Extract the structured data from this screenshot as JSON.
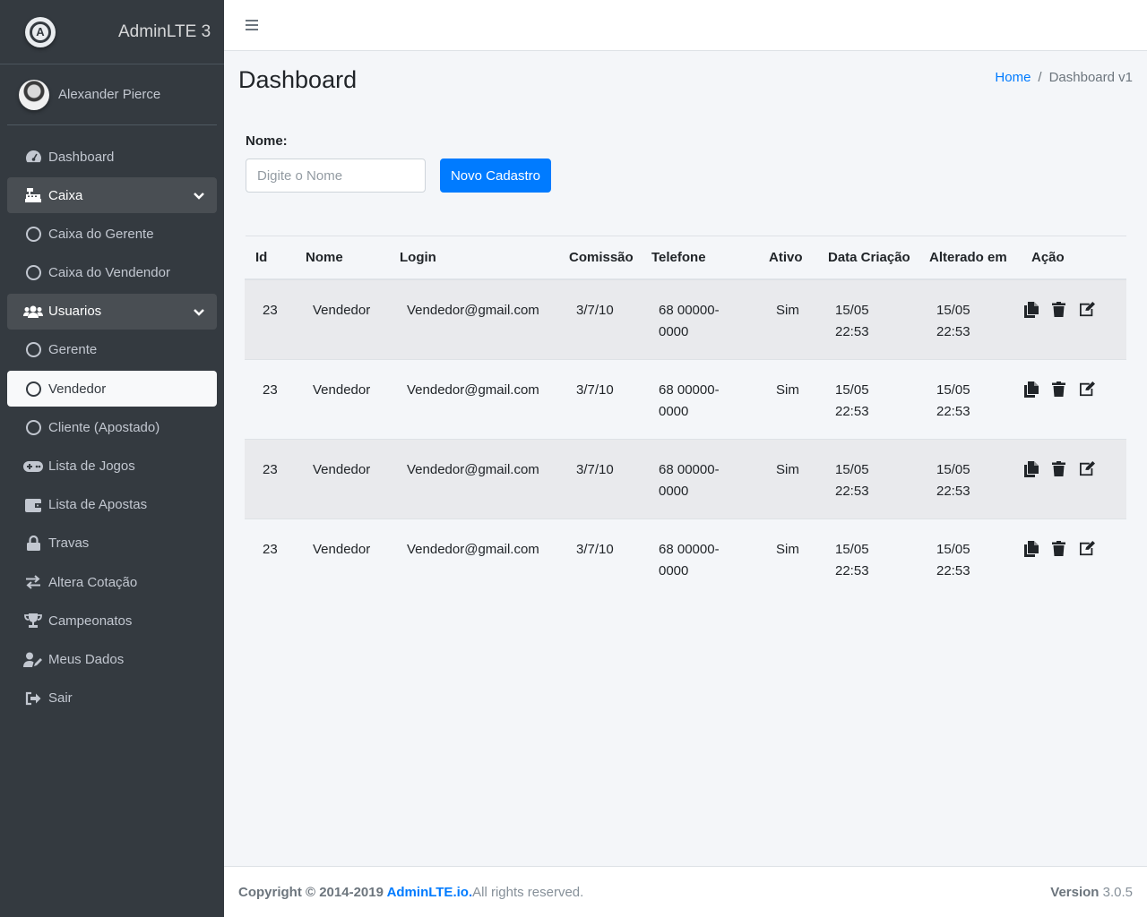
{
  "brand": {
    "title": "AdminLTE 3",
    "logo_letter": "A"
  },
  "user": {
    "name": "Alexander Pierce"
  },
  "sidebar": {
    "items": [
      {
        "label": "Dashboard",
        "icon": "tachometer-icon"
      },
      {
        "label": "Caixa",
        "icon": "cash-register-icon",
        "expanded": true
      },
      {
        "label": "Caixa do Gerente",
        "icon": "circle-icon"
      },
      {
        "label": "Caixa do Vendendor",
        "icon": "circle-icon"
      },
      {
        "label": "Usuarios",
        "icon": "users-icon",
        "expanded": true
      },
      {
        "label": "Gerente",
        "icon": "circle-icon"
      },
      {
        "label": "Vendedor",
        "icon": "circle-icon",
        "active": true
      },
      {
        "label": "Cliente (Apostado)",
        "icon": "circle-icon"
      },
      {
        "label": "Lista de Jogos",
        "icon": "gamepad-icon"
      },
      {
        "label": "Lista de Apostas",
        "icon": "wallet-icon"
      },
      {
        "label": "Travas",
        "icon": "lock-icon"
      },
      {
        "label": "Altera Cotação",
        "icon": "exchange-icon"
      },
      {
        "label": "Campeonatos",
        "icon": "trophy-icon"
      },
      {
        "label": "Meus Dados",
        "icon": "user-edit-icon"
      },
      {
        "label": "Sair",
        "icon": "sign-out-icon"
      }
    ]
  },
  "header": {
    "page_title": "Dashboard",
    "breadcrumb_home": "Home",
    "breadcrumb_current": "Dashboard v1",
    "breadcrumb_sep": "/"
  },
  "form": {
    "name_label": "Nome:",
    "name_placeholder": "Digite o Nome",
    "new_button": "Novo Cadastro"
  },
  "table": {
    "columns": [
      "Id",
      "Nome",
      "Login",
      "Comissão",
      "Telefone",
      "Ativo",
      "Data Criação",
      "Alterado em",
      "Ação"
    ],
    "rows": [
      {
        "id": "23",
        "nome": "Vendedor",
        "login": "Vendedor@gmail.com",
        "comissao": "3/7/10",
        "telefone_1": "68 00000-",
        "telefone_2": "0000",
        "ativo": "Sim",
        "criacao_1": "15/05",
        "criacao_2": "22:53",
        "alterado_1": "15/05",
        "alterado_2": "22:53"
      },
      {
        "id": "23",
        "nome": "Vendedor",
        "login": "Vendedor@gmail.com",
        "comissao": "3/7/10",
        "telefone_1": "68 00000-",
        "telefone_2": "0000",
        "ativo": "Sim",
        "criacao_1": "15/05",
        "criacao_2": "22:53",
        "alterado_1": "15/05",
        "alterado_2": "22:53"
      },
      {
        "id": "23",
        "nome": "Vendedor",
        "login": "Vendedor@gmail.com",
        "comissao": "3/7/10",
        "telefone_1": "68 00000-",
        "telefone_2": "0000",
        "ativo": "Sim",
        "criacao_1": "15/05",
        "criacao_2": "22:53",
        "alterado_1": "15/05",
        "alterado_2": "22:53"
      },
      {
        "id": "23",
        "nome": "Vendedor",
        "login": "Vendedor@gmail.com",
        "comissao": "3/7/10",
        "telefone_1": "68 00000-",
        "telefone_2": "0000",
        "ativo": "Sim",
        "criacao_1": "15/05",
        "criacao_2": "22:53",
        "alterado_1": "15/05",
        "alterado_2": "22:53"
      }
    ],
    "actions": [
      "copy-icon",
      "trash-icon",
      "edit-icon"
    ]
  },
  "footer": {
    "copyright_prefix": "Copyright © 2014-2019 ",
    "copyright_link": "AdminLTE.io.",
    "copyright_suffix": "All rights reserved.",
    "version_label": "Version",
    "version_value": " 3.0.5"
  },
  "colors": {
    "sidebar_bg": "#343a40",
    "primary": "#007bff",
    "content_bg": "#f4f6f9"
  }
}
